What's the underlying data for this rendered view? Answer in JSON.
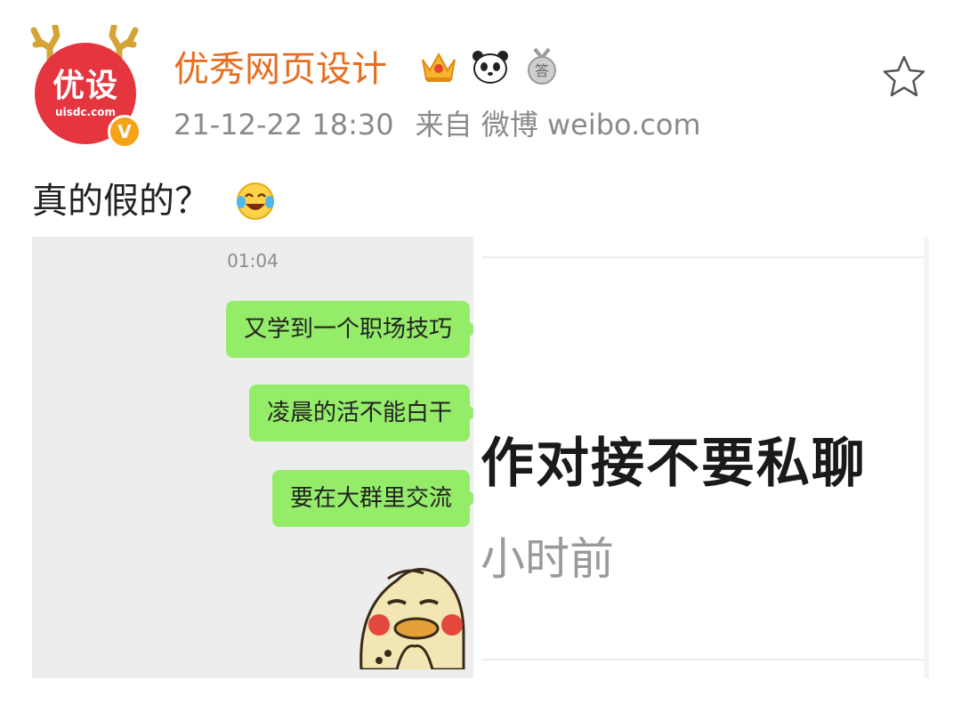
{
  "author": {
    "avatar_text": "优设",
    "avatar_sub": "uisdc.com",
    "verified_mark": "V",
    "name": "优秀网页设计",
    "badges": [
      "crown-badge-icon",
      "panda-badge-icon",
      "answer-medal-icon"
    ],
    "badge_medal_text": "答"
  },
  "post": {
    "date": "21-12-22 18:30",
    "source": "来自 微博 weibo.com",
    "text": "真的假的？",
    "text_emoji": "laugh-cry-emoji-icon"
  },
  "chat_image": {
    "time": "01:04",
    "messages": [
      "又学到一个职场技巧",
      "凌晨的活不能白干",
      "要在大群里交流"
    ]
  },
  "notice_image": {
    "headline": "作对接不要私聊",
    "subtext": "小时前"
  },
  "colors": {
    "brand_red": "#e5353f",
    "username_orange": "#e86d1f",
    "bubble_green": "#95ec69",
    "meta_gray": "#8a8a8a"
  }
}
